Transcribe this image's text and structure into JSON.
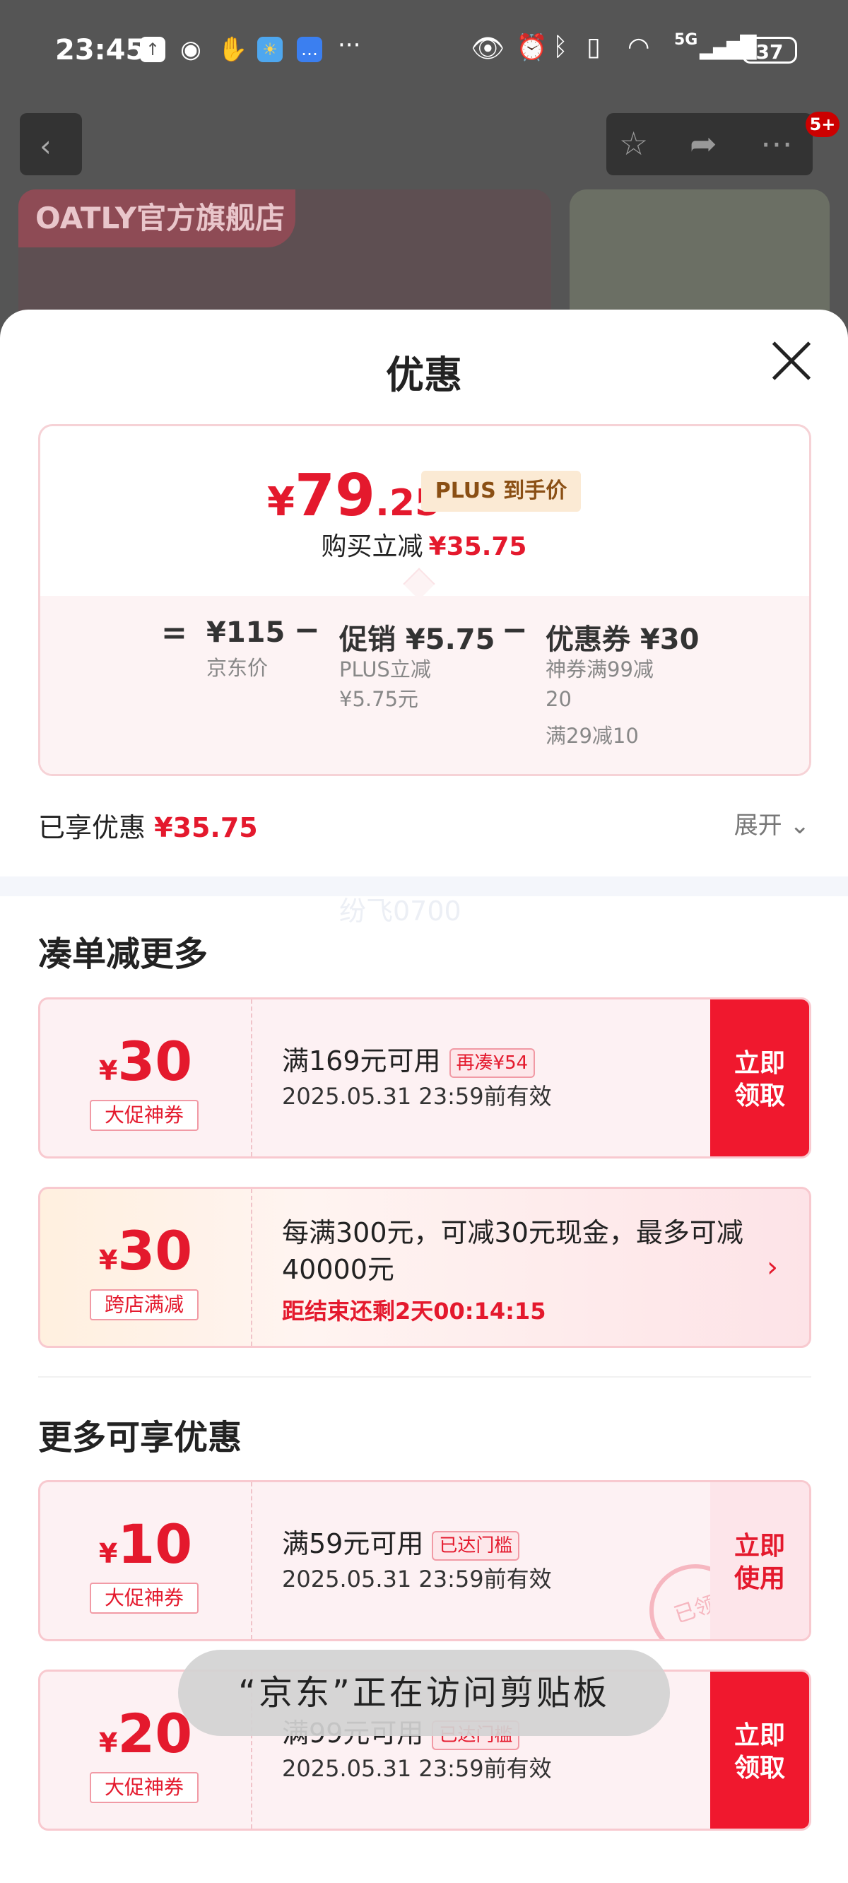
{
  "status_bar": {
    "time": "23:45",
    "network": "5G",
    "battery": "37",
    "icons": [
      "upload-icon",
      "wechat-icon",
      "hand-icon",
      "weather-icon",
      "message-icon",
      "more-icon",
      "eye-icon",
      "alarm-icon",
      "bluetooth-icon",
      "vibrate-icon",
      "wifi-icon",
      "signal-icon",
      "battery-icon"
    ],
    "more_dots": "···"
  },
  "background_page": {
    "store_name": "OATLY官方旗舰店",
    "badge": "5+"
  },
  "sheet": {
    "title": "优惠",
    "price": {
      "currency": "¥",
      "integer": "79",
      "decimal": ".25",
      "tag": "PLUS 到手价"
    },
    "instant_reduction": {
      "label": "购买立减",
      "value": "¥35.75"
    },
    "breakdown": {
      "equals": "=",
      "minus": "−",
      "jd_price": {
        "value": "¥115",
        "label": "京东价"
      },
      "promo": {
        "value": "促销 ¥5.75",
        "line1": "PLUS立减",
        "line2": "¥5.75元"
      },
      "coupon": {
        "value": "优惠券 ¥30",
        "line1": "神券满99减",
        "line2": "20",
        "line3": "满29减10"
      }
    },
    "enjoyed": {
      "label": "已享优惠",
      "value": "¥35.75"
    },
    "expand_label": "展开",
    "watermark": "纷飞0700"
  },
  "section1": {
    "title": "凑单减更多",
    "coupons": [
      {
        "symbol": "¥",
        "amount": "30",
        "type": "大促神券",
        "main": "满169元可用",
        "tag": "再凑¥54",
        "date": "2025.05.31 23:59前有效",
        "btn1": "立即",
        "btn2": "领取"
      },
      {
        "symbol": "¥",
        "amount": "30",
        "type": "跨店满减",
        "desc": "每满300元，可减30元现金，最多可减40000元",
        "countdown": "距结束还剩2天00:14:15",
        "arrow": "›"
      }
    ]
  },
  "section2": {
    "title": "更多可享优惠",
    "coupons": [
      {
        "symbol": "¥",
        "amount": "10",
        "type": "大促神券",
        "main": "满59元可用",
        "tag": "已达门槛",
        "date": "2025.05.31 23:59前有效",
        "btn1": "立即",
        "btn2": "使用",
        "stamp": "已领"
      },
      {
        "symbol": "¥",
        "amount": "20",
        "type": "大促神券",
        "main": "满99元可用",
        "tag": "已达门槛",
        "date": "2025.05.31 23:59前有效",
        "btn1": "立即",
        "btn2": "领取"
      }
    ]
  },
  "toast": "“京东”正在访问剪贴板",
  "colors": {
    "accent": "#e4192d",
    "button": "#f0182e",
    "plus_tag_bg": "#fbead4",
    "plus_tag_text": "#8a4f14"
  }
}
